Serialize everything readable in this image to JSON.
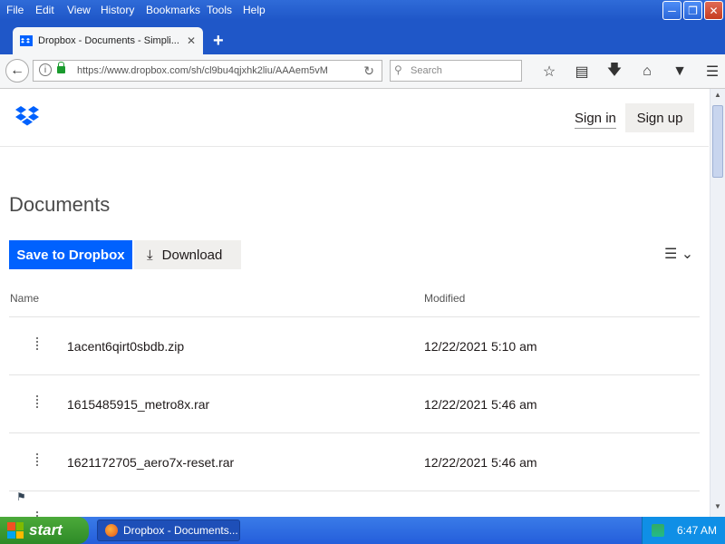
{
  "menubar": {
    "items": [
      "File",
      "Edit",
      "View",
      "History",
      "Bookmarks",
      "Tools",
      "Help"
    ]
  },
  "tab": {
    "title": "Dropbox - Documents - Simpli..."
  },
  "navbar": {
    "url": "https://www.dropbox.com/sh/cl9bu4qjxhk2liu/AAAem5vM",
    "search_placeholder": "Search"
  },
  "site": {
    "sign_in": "Sign in",
    "sign_up": "Sign up"
  },
  "page": {
    "title": "Documents",
    "save_button": "Save to Dropbox",
    "download_button": "Download",
    "columns": {
      "name": "Name",
      "modified": "Modified"
    },
    "files": [
      {
        "name": "1acent6qirt0sbdb.zip",
        "modified": "12/22/2021 5:10 am"
      },
      {
        "name": "1615485915_metro8x.rar",
        "modified": "12/22/2021 5:46 am"
      },
      {
        "name": "1621172705_aero7x-reset.rar",
        "modified": "12/22/2021 5:46 am"
      }
    ]
  },
  "taskbar": {
    "start_label": "start",
    "task_label": "Dropbox - Documents...",
    "clock": "6:47 AM"
  },
  "colors": {
    "accent": "#0061fe",
    "titlebar": "#1f57c8",
    "start_green": "#2d8a27"
  }
}
